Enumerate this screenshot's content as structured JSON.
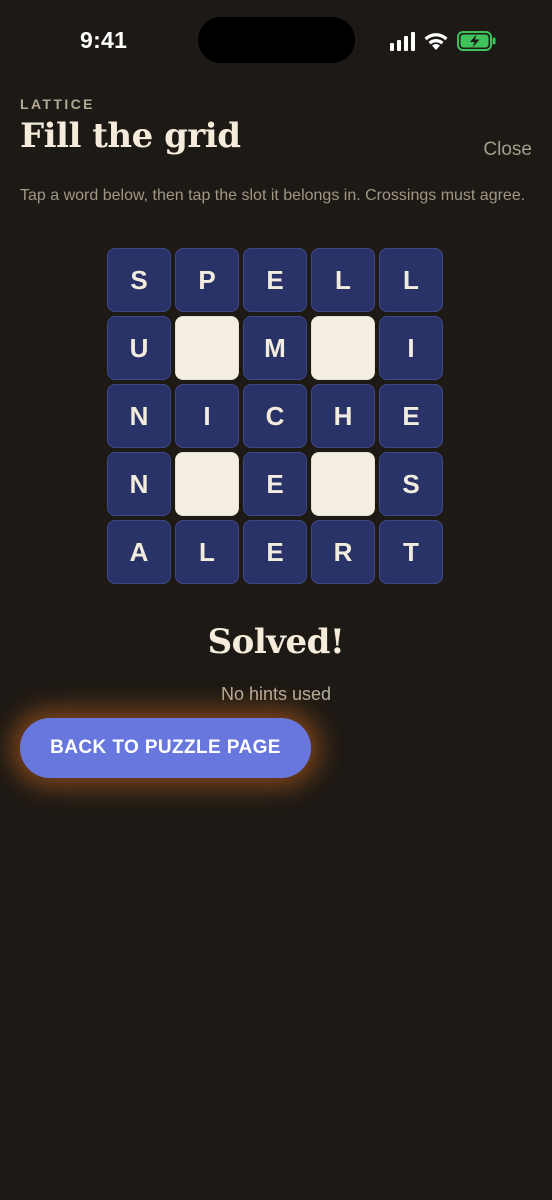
{
  "status_bar": {
    "time": "9:41",
    "icons": [
      "signal-icon",
      "wifi-icon",
      "battery-charging-icon"
    ],
    "battery_color": "#3fc25a"
  },
  "header": {
    "eyebrow": "LATTICE",
    "title": "Fill the grid",
    "close_label": "Close"
  },
  "instructions": "Tap a word below, then tap the slot it belongs in. Crossings must agree.",
  "grid": {
    "rows": [
      [
        "S",
        "P",
        "E",
        "L",
        "L"
      ],
      [
        "U",
        "",
        "M",
        "",
        "I"
      ],
      [
        "N",
        "I",
        "C",
        "H",
        "E"
      ],
      [
        "N",
        "",
        "E",
        "",
        "S"
      ],
      [
        "A",
        "L",
        "E",
        "R",
        "T"
      ]
    ],
    "letter_cell_color": "#293368",
    "block_cell_color": "#f5eee2"
  },
  "result": {
    "title": "Solved!",
    "hints": "No hints used",
    "button_label": "BACK TO PUZZLE PAGE",
    "button_color": "#6877dd",
    "glow_color": "#d66e22"
  }
}
